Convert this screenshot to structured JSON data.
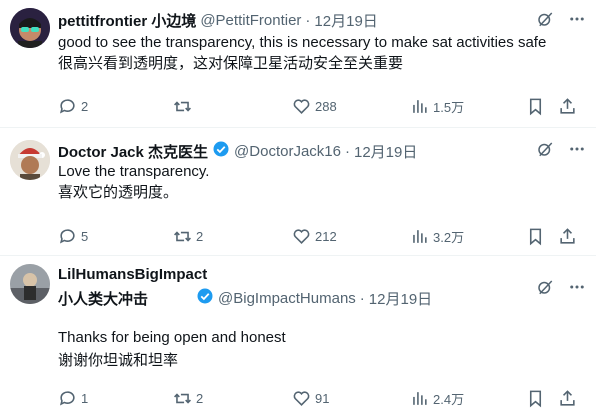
{
  "tweets": [
    {
      "name": "pettitfrontier 小边境",
      "handle": "@PettitFrontier",
      "date": "12月19日",
      "verified": false,
      "lines": [
        "good to see the transparency, this is necessary to make sat activities safe",
        "很高兴看到透明度，这对保障卫星活动安全至关重要"
      ],
      "replies": "2",
      "reposts": "",
      "likes": "288",
      "views": "1.5万"
    },
    {
      "name": "Doctor Jack 杰克医生",
      "handle": "@DoctorJack16",
      "date": "12月19日",
      "verified": true,
      "lines": [
        "Love the transparency.",
        "喜欢它的透明度。"
      ],
      "replies": "5",
      "reposts": "2",
      "likes": "212",
      "views": "3.2万"
    },
    {
      "name": "LilHumansBigImpact",
      "name2": "小人类大冲击",
      "handle": "@BigImpactHumans",
      "date": "12月19日",
      "verified": true,
      "lines": [
        "Thanks for being open and honest",
        "谢谢你坦诚和坦率"
      ],
      "replies": "1",
      "reposts": "2",
      "likes": "91",
      "views": "2.4万"
    }
  ],
  "separator": "·",
  "colors": {
    "text": "#0f1419",
    "muted": "#536471",
    "verified": "#1d9bf0",
    "divider": "#eff3f4"
  }
}
